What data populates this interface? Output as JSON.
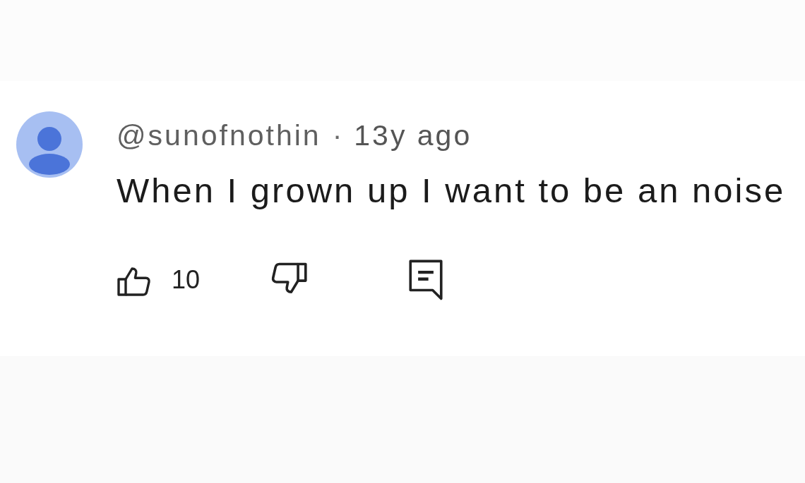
{
  "comment": {
    "author": "@sunofnothin",
    "separator": "·",
    "time": "13y ago",
    "text": "When I grown up I want to be an noise",
    "like_count": "10"
  }
}
